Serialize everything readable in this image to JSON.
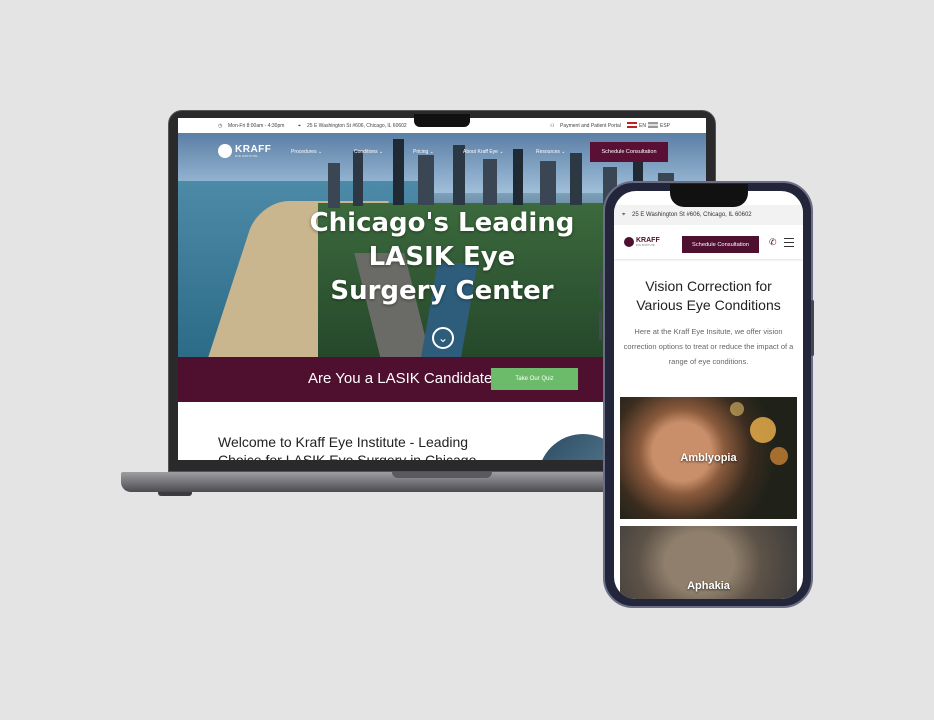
{
  "desktop": {
    "topbar": {
      "hours": "Mon-Fri 8:00am - 4:30pm",
      "address": "25 E Washington St #606, Chicago, IL 60602",
      "portal": "Payment and Patient Portal",
      "lang_en": "EN",
      "lang_esp": "ESP"
    },
    "logo": {
      "name": "KRAFF",
      "tagline": "EYE INSTITUTE"
    },
    "nav": {
      "items": [
        "Procedures",
        "Conditions",
        "Pricing",
        "About Kraff Eye",
        "Resources"
      ],
      "cta": "Schedule Consultation"
    },
    "hero": {
      "title_line1": "Chicago's Leading",
      "title_line2": "LASIK Eye",
      "title_line3": "Surgery Center"
    },
    "quiz": {
      "text": "Are You a LASIK Candidate?",
      "button": "Take Our Quiz"
    },
    "welcome": "Welcome to Kraff Eye Institute - Leading Choice for LASIK Eye Surgery in Chicago"
  },
  "mobile": {
    "address": "25 E Washington St #606, Chicago, IL 60602",
    "logo": {
      "name": "KRAFF",
      "tagline": "EYE INSTITUTE"
    },
    "cta": "Schedule Consultation",
    "section_title_line1": "Vision Correction for",
    "section_title_line2": "Various Eye Conditions",
    "section_desc": "Here at the Kraff Eye Insitute, we offer vision correction options to treat or reduce the impact of a range of eye conditions.",
    "cards": [
      {
        "label": "Amblyopia"
      },
      {
        "label": "Aphakia"
      }
    ]
  },
  "colors": {
    "brand": "#4f0f2f",
    "quiz_button": "#6cbb6a"
  }
}
